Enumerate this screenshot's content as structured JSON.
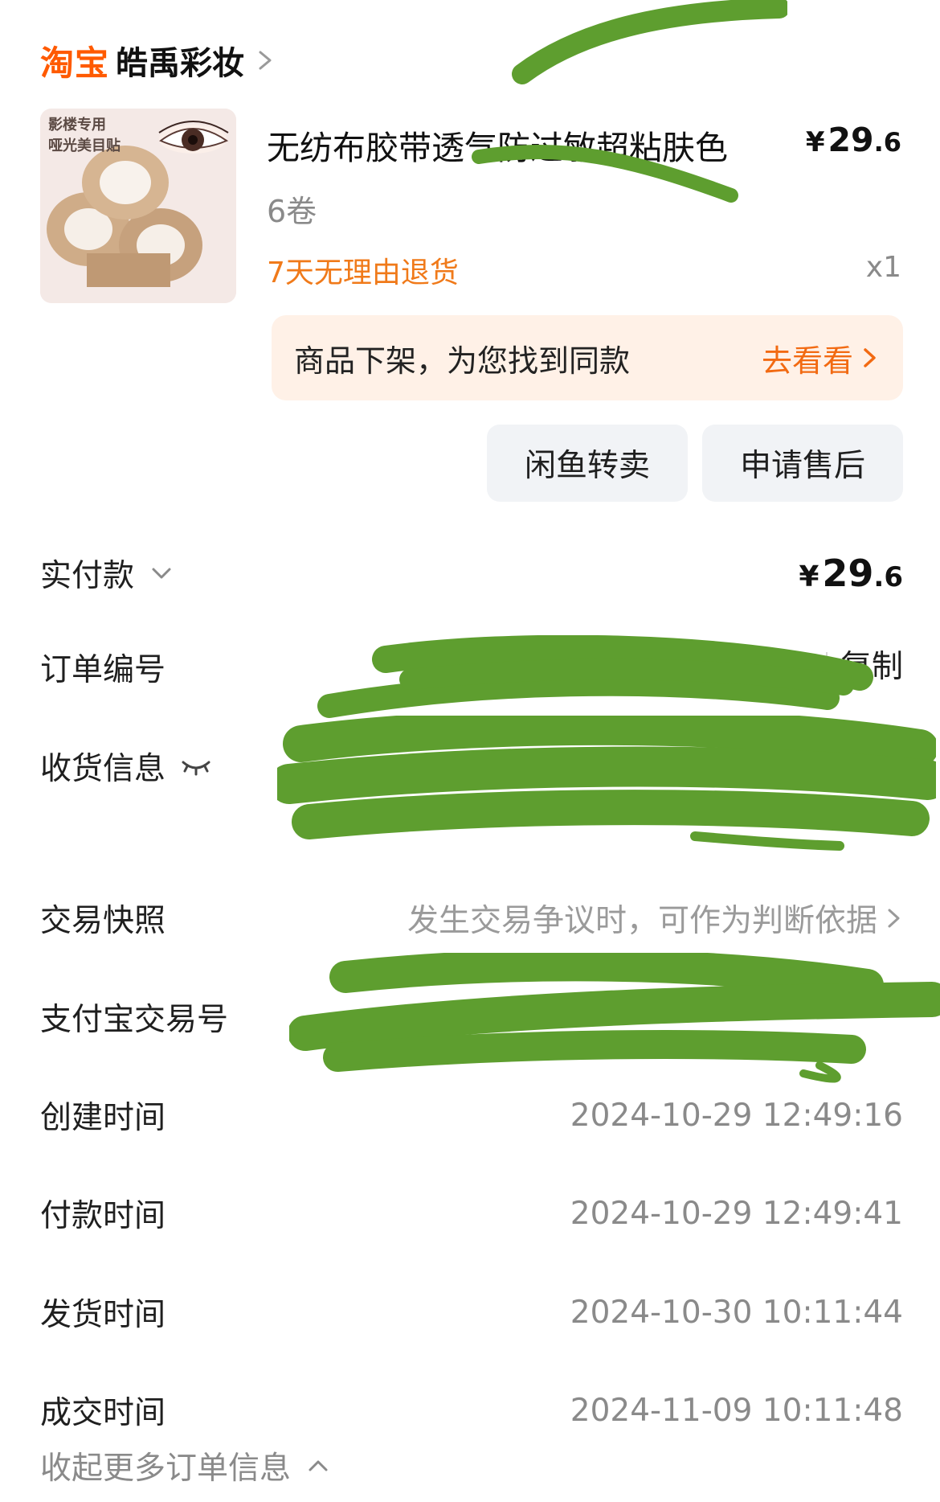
{
  "shop": {
    "platform_logo": "淘宝",
    "name": "皓禹彩妆"
  },
  "product": {
    "image_caption": [
      "影楼专用",
      "哑光美目贴"
    ],
    "title": "无纺布胶带透气防过敏超粘肤色",
    "price_symbol": "¥",
    "price_int": "29",
    "price_dec": ".6",
    "spec": "6卷",
    "return_policy": "7天无理由退货",
    "quantity": "x1"
  },
  "delisted_banner": {
    "message": "商品下架，为您找到同款",
    "link_label": "去看看"
  },
  "actions": {
    "resell_label": "闲鱼转卖",
    "after_sale_label": "申请售后"
  },
  "order_info": {
    "total_label": "实付款",
    "total_symbol": "¥",
    "total_int": "29",
    "total_dec": ".6",
    "order_no_label": "订单编号",
    "copy_label": "复制",
    "shipping_label": "收货信息",
    "snapshot_label": "交易快照",
    "snapshot_hint": "发生交易争议时，可作为判断依据",
    "alipay_label": "支付宝交易号",
    "created_label": "创建时间",
    "created_value": "2024-10-29 12:49:16",
    "paid_label": "付款时间",
    "paid_value": "2024-10-29 12:49:41",
    "shipped_label": "发货时间",
    "shipped_value": "2024-10-30 10:11:44",
    "completed_label": "成交时间",
    "completed_value": "2024-11-09 10:11:48",
    "collapse_label": "收起更多订单信息"
  },
  "colors": {
    "brand_orange": "#ff5a00",
    "accent_orange": "#f26a12",
    "banner_bg": "#fff1e7",
    "button_bg": "#f1f3f6",
    "redaction_green": "#5e9e2f"
  },
  "icons": {
    "shop_chevron": "chevron-right-icon",
    "total_toggle": "chevron-down-icon",
    "privacy_toggle": "eye-closed-icon",
    "collapse": "chevron-up-icon"
  }
}
